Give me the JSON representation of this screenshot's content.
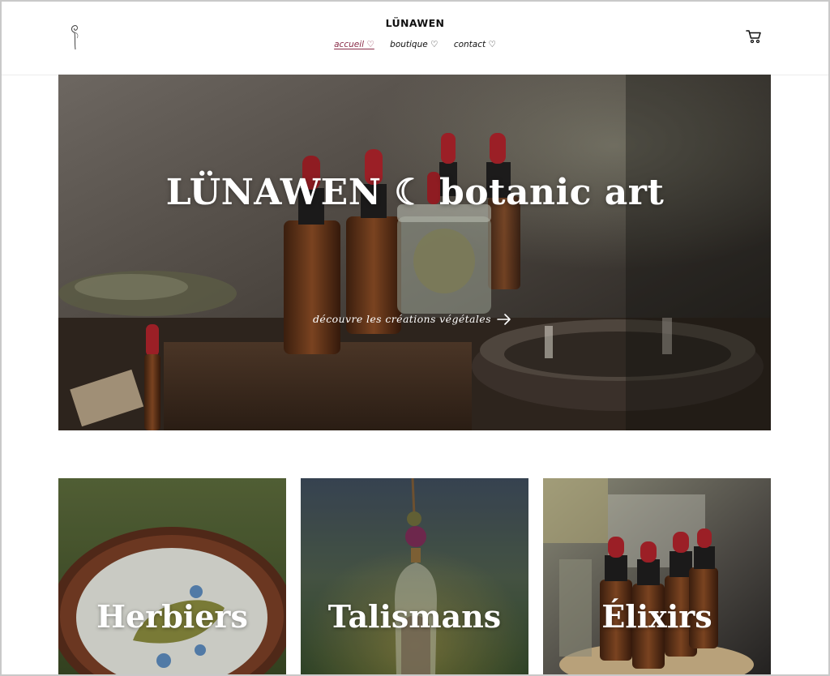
{
  "header": {
    "site_title": "LÜNAWEN",
    "logo_icon": "dandelion-sprig-icon",
    "cart_icon": "cart-icon",
    "nav": [
      {
        "label": "accueil ♡",
        "active": true
      },
      {
        "label": "boutique ♡",
        "active": false
      },
      {
        "label": "contact ♡",
        "active": false
      }
    ]
  },
  "hero": {
    "title": "LÜNAWEN ☾ botanic art",
    "cta_label": "découvre les créations végétales",
    "cta_icon": "arrow-right-icon"
  },
  "categories": [
    {
      "label": "Herbiers"
    },
    {
      "label": "Talismans"
    },
    {
      "label": "Élixirs"
    }
  ],
  "colors": {
    "accent": "#8a2c48",
    "text": "#111111",
    "background": "#ffffff"
  }
}
